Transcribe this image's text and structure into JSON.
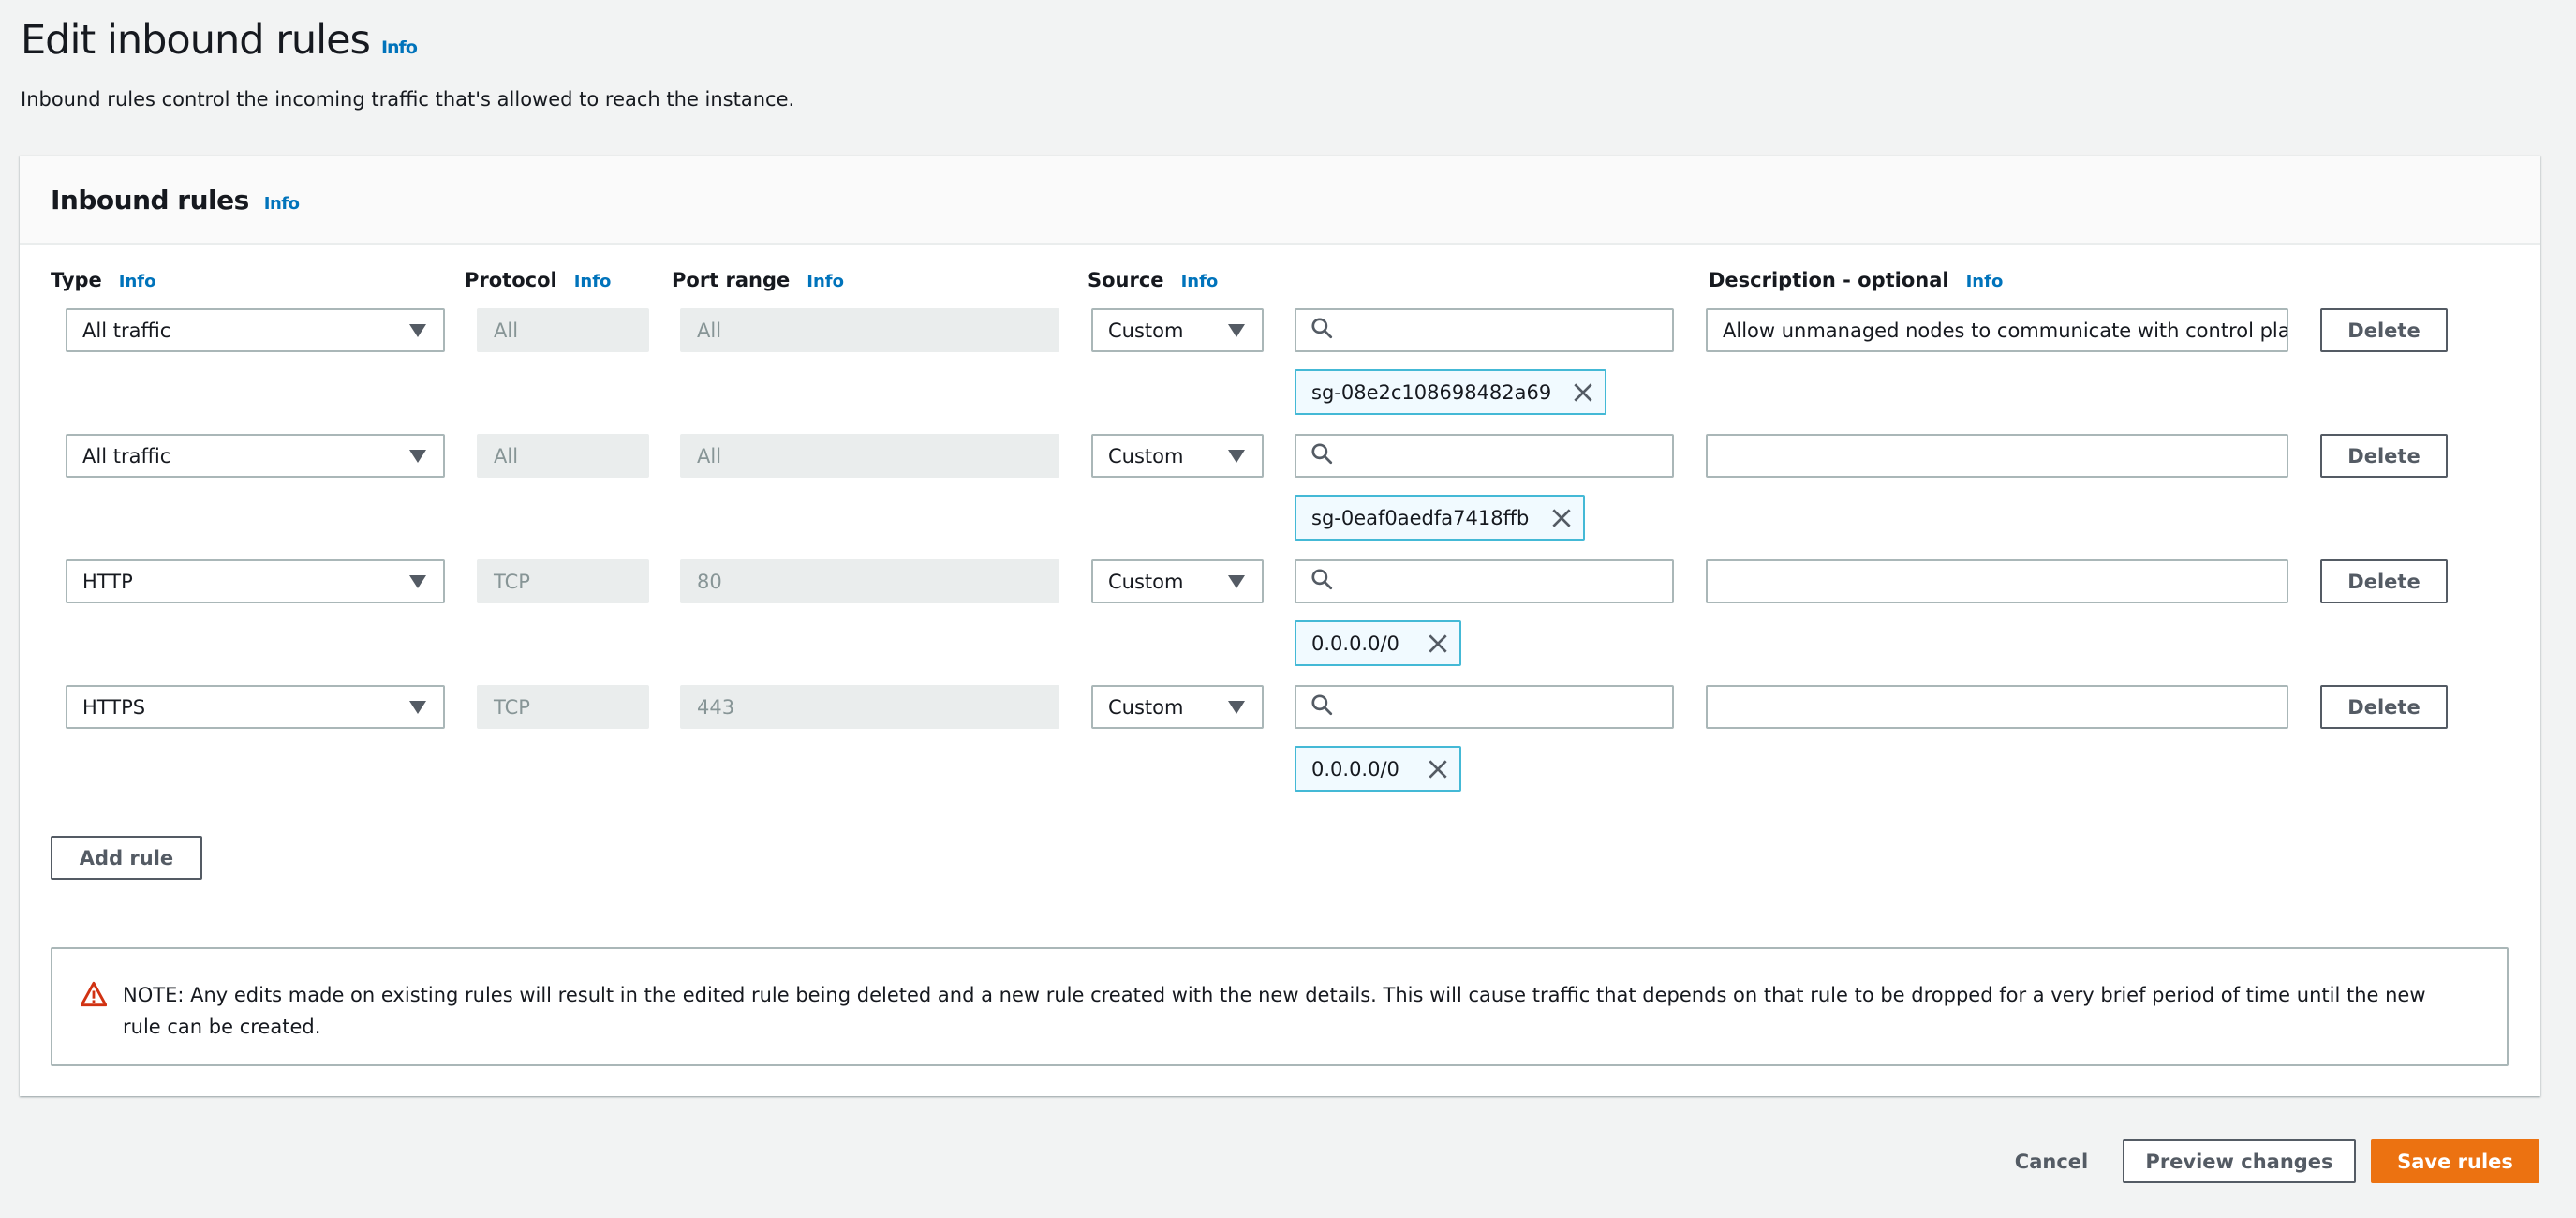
{
  "header": {
    "title": "Edit inbound rules",
    "info": "Info",
    "subtitle": "Inbound rules control the incoming traffic that's allowed to reach the instance."
  },
  "panel": {
    "title": "Inbound rules",
    "info": "Info",
    "columns": [
      {
        "label": "Type",
        "info": "Info"
      },
      {
        "label": "Protocol",
        "info": "Info"
      },
      {
        "label": "Port range",
        "info": "Info"
      },
      {
        "label": "Source",
        "info": "Info"
      },
      {
        "label": "Description - optional",
        "info": "Info"
      }
    ],
    "rules": [
      {
        "type": "All traffic",
        "protocol": "All",
        "port_range": "All",
        "source": "Custom",
        "search": "",
        "token": "sg-08e2c108698482a69",
        "description": "Allow unmanaged nodes to communicate with control pla",
        "delete": "Delete"
      },
      {
        "type": "All traffic",
        "protocol": "All",
        "port_range": "All",
        "source": "Custom",
        "search": "",
        "token": "sg-0eaf0aedfa7418ffb",
        "description": "",
        "delete": "Delete"
      },
      {
        "type": "HTTP",
        "protocol": "TCP",
        "port_range": "80",
        "source": "Custom",
        "search": "",
        "token": "0.0.0.0/0",
        "description": "",
        "delete": "Delete"
      },
      {
        "type": "HTTPS",
        "protocol": "TCP",
        "port_range": "443",
        "source": "Custom",
        "search": "",
        "token": "0.0.0.0/0",
        "description": "",
        "delete": "Delete"
      }
    ],
    "add_rule": "Add rule",
    "note": "NOTE: Any edits made on existing rules will result in the edited rule being deleted and a new rule created with the new details. This will cause traffic that depends on that rule to be dropped for a very brief period of time until the new rule can be created."
  },
  "footer": {
    "cancel": "Cancel",
    "preview": "Preview changes",
    "save": "Save rules"
  },
  "colors": {
    "accent": "#ec7211",
    "link": "#0073bb",
    "token_border": "#44b9d6",
    "warning": "#d13212"
  }
}
